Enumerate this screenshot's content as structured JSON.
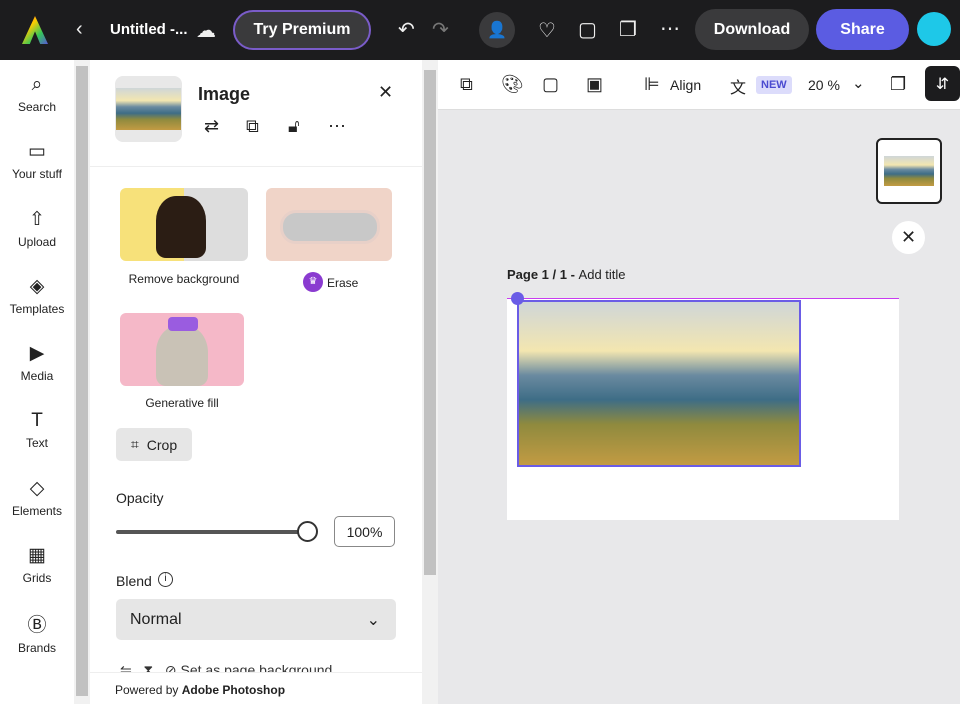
{
  "topbar": {
    "title": "Untitled -...",
    "premium": "Try Premium",
    "download": "Download",
    "share": "Share"
  },
  "rail": [
    {
      "label": "Search",
      "icon": "⌕"
    },
    {
      "label": "Your stuff",
      "icon": "▭"
    },
    {
      "label": "Upload",
      "icon": "⇧"
    },
    {
      "label": "Templates",
      "icon": "◈"
    },
    {
      "label": "Media",
      "icon": "▶"
    },
    {
      "label": "Text",
      "icon": "T"
    },
    {
      "label": "Elements",
      "icon": "◇"
    },
    {
      "label": "Grids",
      "icon": "▦"
    },
    {
      "label": "Brands",
      "icon": "Ⓑ"
    }
  ],
  "panel": {
    "heading": "Image",
    "tools": [
      {
        "label": "Remove background"
      },
      {
        "label": "Erase"
      },
      {
        "label": "Generative fill"
      }
    ],
    "crop": "Crop",
    "opacity_label": "Opacity",
    "opacity_value": "100%",
    "opacity_fraction": 1.0,
    "blend_label": "Blend",
    "blend_value": "Normal",
    "partial_action": "Set as page background",
    "footer_prefix": "Powered by ",
    "footer_brand": "Adobe Photoshop"
  },
  "toolbar": {
    "align": "Align",
    "new_badge": "NEW",
    "zoom": "20 %"
  },
  "canvas": {
    "page_label": "Page 1 / 1 - ",
    "add_title": "Add title"
  }
}
